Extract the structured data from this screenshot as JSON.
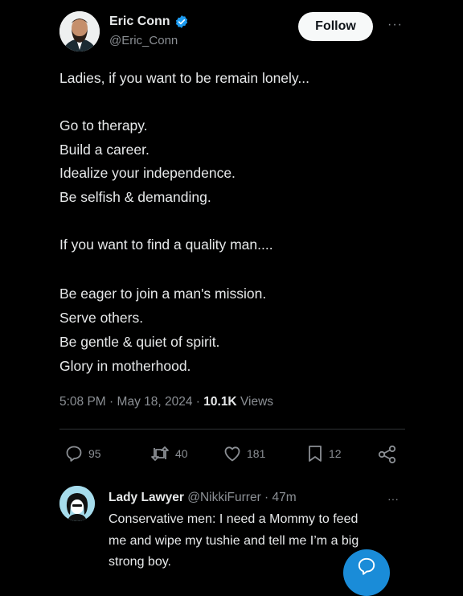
{
  "tweet": {
    "author_name": "Eric Conn",
    "author_handle": "@Eric_Conn",
    "follow_label": "Follow",
    "more_label": "···",
    "lines": [
      "Ladies, if you want to be remain lonely...",
      "Go to therapy.",
      "Build a career.",
      "Idealize your independence.",
      "Be selfish & demanding.",
      "If you want to find a quality man....",
      "Be eager to join a man's mission.",
      "Serve others.",
      "Be gentle & quiet of spirit.",
      "Glory in motherhood."
    ],
    "time": "5:08 PM",
    "date": "May 18, 2024",
    "views_count": "10.1K",
    "views_label": "Views",
    "separator": "·"
  },
  "actions": {
    "replies": "95",
    "reposts": "40",
    "likes": "181",
    "bookmarks": "12"
  },
  "reply": {
    "author_name": "Lady Lawyer",
    "author_handle": "@NikkiFurrer",
    "time": "· 47m",
    "more_label": "···",
    "lines": [
      "Conservative men: I need a Mommy to feed",
      "me and wipe my tushie and tell me I’m a big",
      "strong boy."
    ]
  },
  "colors": {
    "background": "#000000",
    "text": "#e7e9ea",
    "muted": "#8b8f94",
    "verified": "#1d9bf0",
    "fab": "#1a8cd8"
  }
}
